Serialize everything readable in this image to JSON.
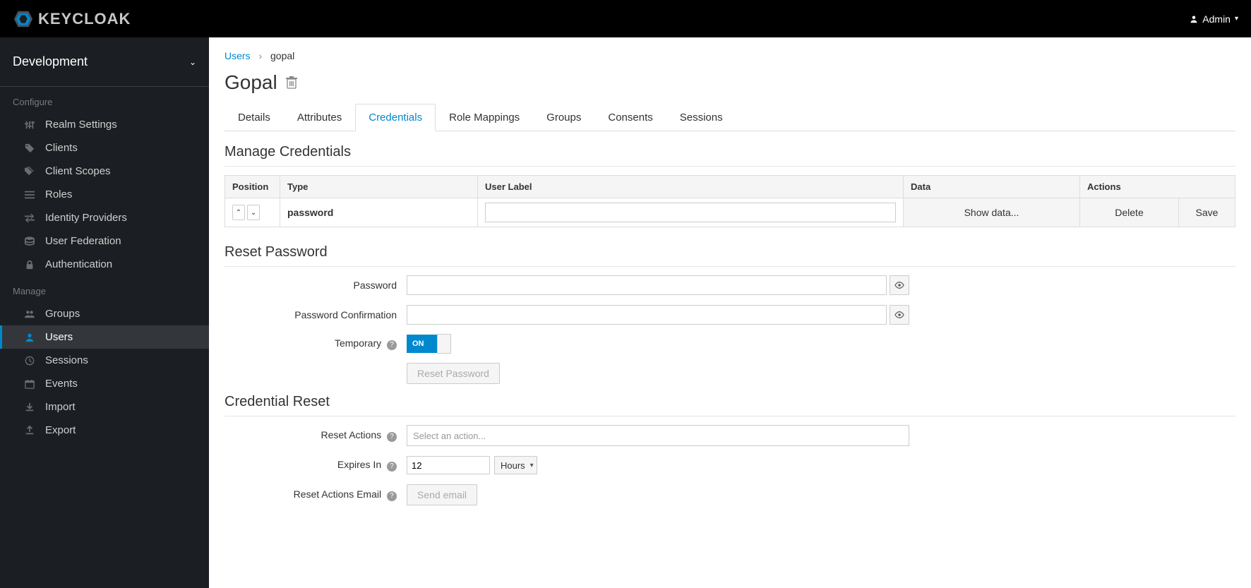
{
  "topbar": {
    "brand": "KEYCLOAK",
    "user_label": "Admin"
  },
  "realm": {
    "name": "Development"
  },
  "sidebar": {
    "configure_label": "Configure",
    "manage_label": "Manage",
    "configure_items": [
      {
        "label": "Realm Settings",
        "icon": "sliders"
      },
      {
        "label": "Clients",
        "icon": "tag"
      },
      {
        "label": "Client Scopes",
        "icon": "tags"
      },
      {
        "label": "Roles",
        "icon": "list"
      },
      {
        "label": "Identity Providers",
        "icon": "exchange"
      },
      {
        "label": "User Federation",
        "icon": "database"
      },
      {
        "label": "Authentication",
        "icon": "lock"
      }
    ],
    "manage_items": [
      {
        "label": "Groups",
        "icon": "users"
      },
      {
        "label": "Users",
        "icon": "user",
        "active": true
      },
      {
        "label": "Sessions",
        "icon": "clock"
      },
      {
        "label": "Events",
        "icon": "calendar"
      },
      {
        "label": "Import",
        "icon": "download"
      },
      {
        "label": "Export",
        "icon": "upload"
      }
    ]
  },
  "breadcrumb": {
    "parent": "Users",
    "current": "gopal"
  },
  "page": {
    "title": "Gopal"
  },
  "tabs": [
    "Details",
    "Attributes",
    "Credentials",
    "Role Mappings",
    "Groups",
    "Consents",
    "Sessions"
  ],
  "active_tab": "Credentials",
  "manage_credentials": {
    "title": "Manage Credentials",
    "headers": {
      "position": "Position",
      "type": "Type",
      "user_label": "User Label",
      "data": "Data",
      "actions": "Actions"
    },
    "row": {
      "type": "password",
      "user_label": "",
      "show_data": "Show data...",
      "delete": "Delete",
      "save": "Save"
    }
  },
  "reset_password": {
    "title": "Reset Password",
    "password_label": "Password",
    "confirm_label": "Password Confirmation",
    "temporary_label": "Temporary",
    "toggle_on": "ON",
    "button": "Reset Password"
  },
  "credential_reset": {
    "title": "Credential Reset",
    "reset_actions_label": "Reset Actions",
    "reset_actions_placeholder": "Select an action...",
    "expires_label": "Expires In",
    "expires_value": "12",
    "expires_unit": "Hours",
    "email_label": "Reset Actions Email",
    "send_button": "Send email"
  }
}
